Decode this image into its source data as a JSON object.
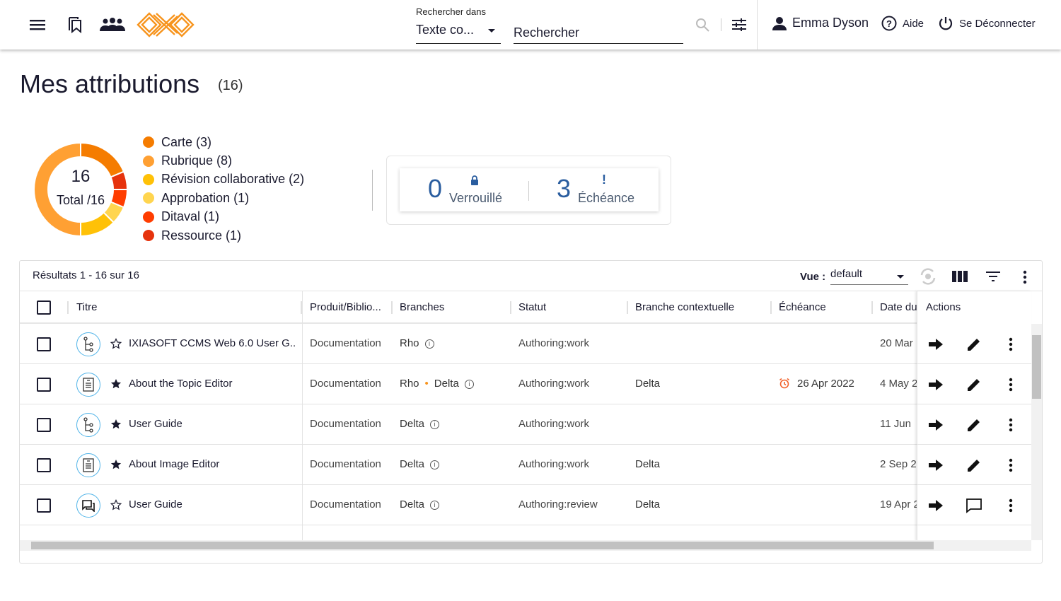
{
  "header": {
    "search_in_label": "Rechercher dans",
    "search_in_value": "Texte co...",
    "search_placeholder": "Rechercher",
    "user": "Emma Dyson",
    "help": "Aide",
    "logout": "Se Déconnecter",
    "brand_color": "#f7941d"
  },
  "page": {
    "title": "Mes attributions",
    "count": "(16)"
  },
  "summary": {
    "total": "16",
    "total_label": "Total /16",
    "legend": [
      {
        "label": "Carte (3)",
        "value": 3,
        "color": "#f57c00"
      },
      {
        "label": "Rubrique (8)",
        "value": 8,
        "color": "#ffa033"
      },
      {
        "label": "Révision collaborative (2)",
        "value": 2,
        "color": "#ffc107"
      },
      {
        "label": "Approbation (1)",
        "value": 1,
        "color": "#ffd54f"
      },
      {
        "label": "Ditaval (1)",
        "value": 1,
        "color": "#ff3d00"
      },
      {
        "label": "Ressource (1)",
        "value": 1,
        "color": "#e6330d"
      }
    ],
    "locked_count": "0",
    "locked_label": "Verrouillé",
    "due_count": "3",
    "due_label": "Échéance"
  },
  "table": {
    "results": "Résultats 1 - 16 sur 16",
    "view_label": "Vue :",
    "view_value": "default",
    "columns": [
      "Titre",
      "Produit/Biblio...",
      "Branches",
      "Statut",
      "Branche contextuelle",
      "Échéance",
      "Date du",
      "Actions"
    ],
    "rows": [
      {
        "type": "map",
        "starred": false,
        "title": "IXIASOFT CCMS Web 6.0 User G...",
        "product": "Documentation",
        "branch": "Rho",
        "branch2": "",
        "status": "Authoring:work",
        "context": "",
        "due": "",
        "date": "20 Mar",
        "edit": "pencil"
      },
      {
        "type": "topic",
        "starred": true,
        "title": "About the Topic Editor",
        "product": "Documentation",
        "branch": "Rho",
        "branch2": "Delta",
        "status": "Authoring:work",
        "context": "Delta",
        "due": "26 Apr 2022",
        "date": "4 May 2",
        "edit": "pencil"
      },
      {
        "type": "map",
        "starred": true,
        "title": "User Guide",
        "product": "Documentation",
        "branch": "Delta",
        "branch2": "",
        "status": "Authoring:work",
        "context": "",
        "due": "",
        "date": "11 Jun",
        "edit": "pencil"
      },
      {
        "type": "topic",
        "starred": true,
        "title": "About Image Editor",
        "product": "Documentation",
        "branch": "Delta",
        "branch2": "",
        "status": "Authoring:work",
        "context": "Delta",
        "due": "",
        "date": "2 Sep 2",
        "edit": "pencil"
      },
      {
        "type": "review",
        "starred": false,
        "title": "User Guide",
        "product": "Documentation",
        "branch": "Delta",
        "branch2": "",
        "status": "Authoring:review",
        "context": "Delta",
        "due": "",
        "date": "19 Apr 2",
        "edit": "comment"
      }
    ]
  }
}
